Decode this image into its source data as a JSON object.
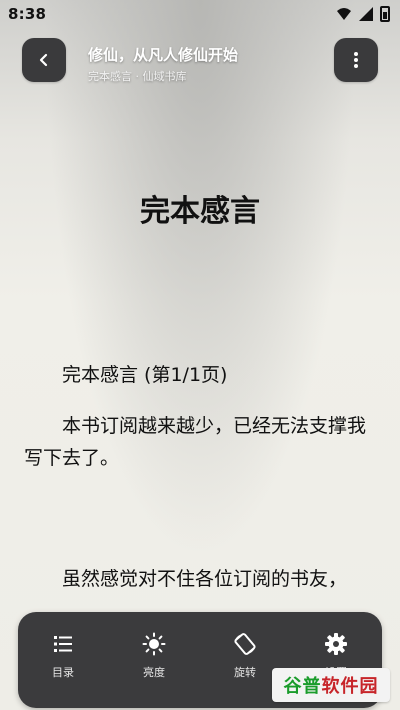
{
  "status_bar": {
    "time": "8:38"
  },
  "top_bar": {
    "book_title": "修仙，从凡人修仙开始",
    "subtitle": "完本感言 · 仙域书库"
  },
  "chapter": {
    "title": "完本感言",
    "page_indicator": "完本感言 (第1/1页)",
    "paragraphs": [
      "本书订阅越来越少，已经无法支撑我写下去了。",
      "虽然感觉对不住各位订阅的书友，"
    ]
  },
  "bottom_menu": {
    "items": [
      {
        "label": "目录",
        "icon": "list-icon"
      },
      {
        "label": "亮度",
        "icon": "brightness-icon"
      },
      {
        "label": "旋转",
        "icon": "rotate-icon"
      },
      {
        "label": "设置",
        "icon": "gear-icon"
      }
    ]
  },
  "watermark": {
    "part1": "谷普",
    "part2": "软件园"
  },
  "colors": {
    "bar_background": "#3b3b3d",
    "watermark_green": "#1a9c2b",
    "watermark_red": "#c7252a"
  }
}
